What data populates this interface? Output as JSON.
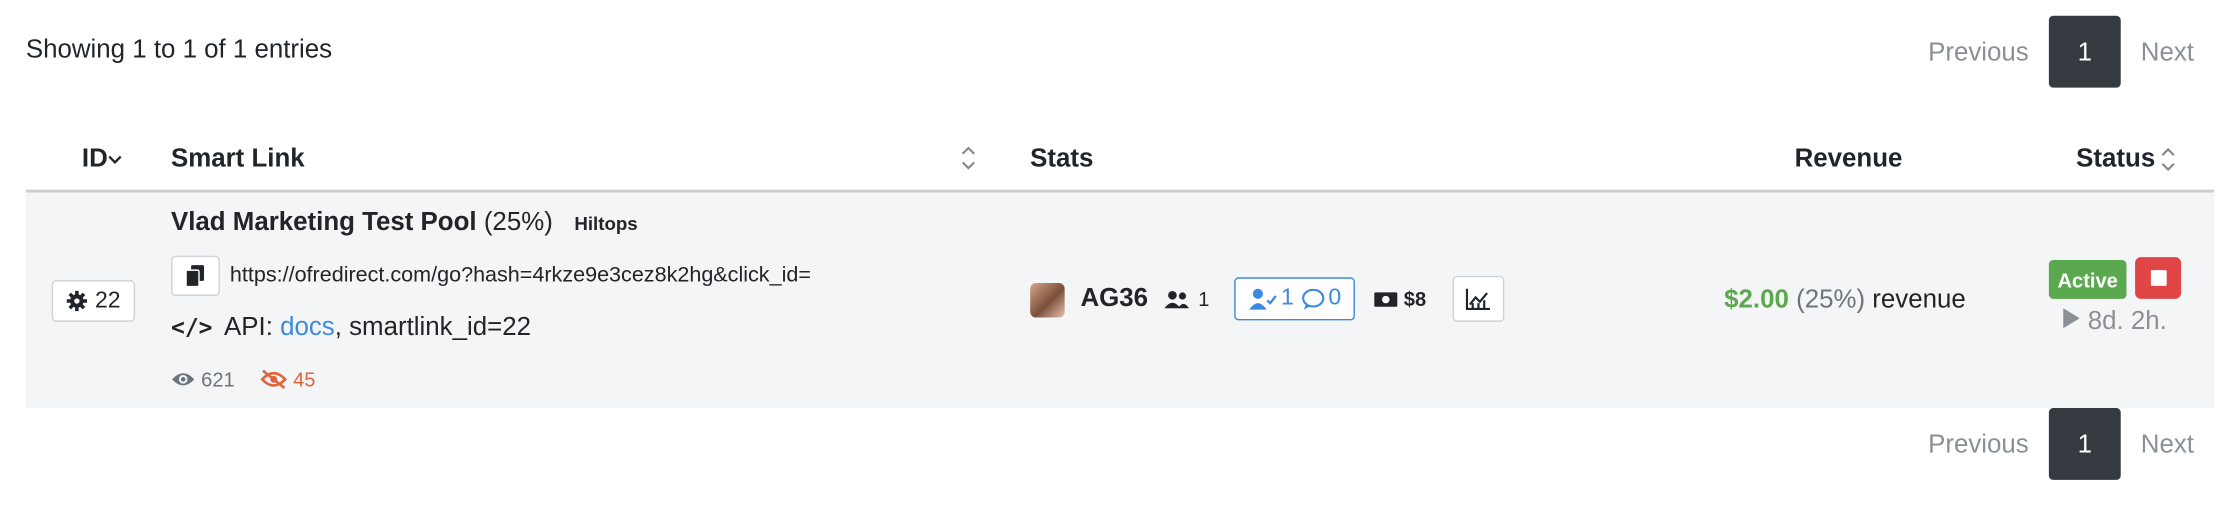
{
  "info": {
    "showing": "Showing 1 to 1 of 1 entries"
  },
  "pagination": {
    "previous": "Previous",
    "current": "1",
    "next": "Next"
  },
  "columns": {
    "id": "ID",
    "smart_link": "Smart Link",
    "stats": "Stats",
    "revenue": "Revenue",
    "status": "Status"
  },
  "row": {
    "id": "22",
    "title": "Vlad Marketing Test Pool",
    "share": "(25%)",
    "network": "Hiltops",
    "url": "https://ofredirect.com/go?hash=4rkze9e3cez8k2hg&click_id=",
    "api_label": "API:",
    "api_link": "docs",
    "api_suffix": ", smartlink_id=22",
    "views": "621",
    "hidden_views": "45",
    "user": "AG36",
    "users_count": "1",
    "subscribers": "1",
    "messages": "0",
    "cost": "$8",
    "revenue_amount": "$2.00",
    "revenue_pct": "(25%)",
    "revenue_label": "revenue",
    "status": "Active",
    "runtime": "8d. 2h."
  },
  "colors": {
    "accent": "#3a8be0",
    "success": "#5aa94f",
    "danger": "#e04646",
    "dark": "#343a40",
    "warning": "#e0643d"
  }
}
